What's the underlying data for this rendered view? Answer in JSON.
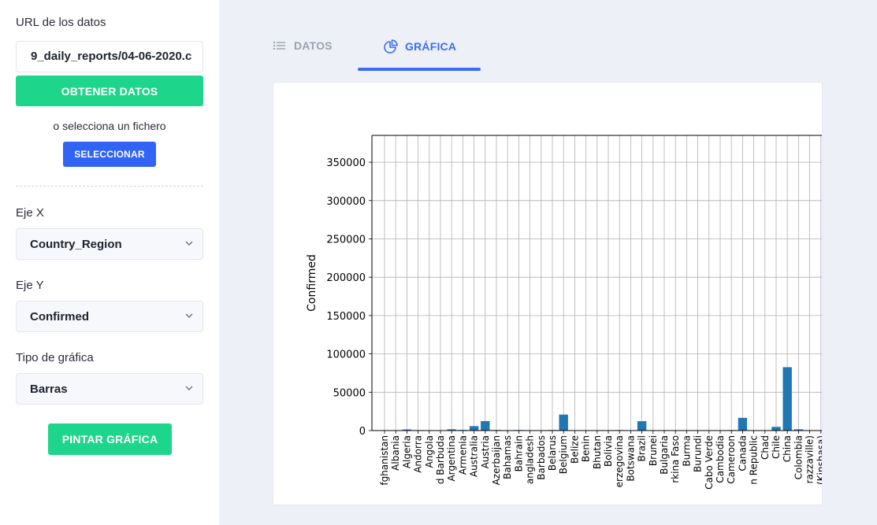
{
  "sidebar": {
    "url_label": "URL de los datos",
    "url_value": "9_daily_reports/04-06-2020.c",
    "fetch_button": "OBTENER DATOS",
    "or_select_text": "o selecciona un fichero",
    "select_button": "SELECCIONAR",
    "x_axis_label": "Eje X",
    "x_axis_value": "Country_Region",
    "y_axis_label": "Eje Y",
    "y_axis_value": "Confirmed",
    "chart_type_label": "Tipo de gráfica",
    "chart_type_value": "Barras",
    "paint_button": "PINTAR GRÁFICA"
  },
  "tabs": [
    {
      "label": "DATOS",
      "icon": "list-icon",
      "active": false
    },
    {
      "label": "GRÁFICA",
      "icon": "pie-chart-icon",
      "active": true
    }
  ],
  "colors": {
    "accent": "#3b6cf6",
    "green": "#1ed58c",
    "blue_button": "#3163f5",
    "bar": "#1f77b4"
  },
  "chart_data": {
    "type": "bar",
    "ylabel": "Confirmed",
    "ylim": [
      0,
      385000
    ],
    "yticks": [
      0,
      50000,
      100000,
      150000,
      200000,
      250000,
      300000,
      350000
    ],
    "ytick_labels": [
      "0",
      "50000",
      "100000",
      "150000",
      "200000",
      "250000",
      "300000",
      "350000"
    ],
    "grid": true,
    "categories": [
      "fghanistan",
      "Albania",
      "Algeria",
      "Andorra",
      "Angola",
      "d Barbuda",
      "Argentina",
      "Armenia",
      "Australia",
      "Austria",
      "Azerbaijan",
      "Bahamas",
      "Bahrain",
      "angladesh",
      "Barbados",
      "Belarus",
      "Belgium",
      "Belize",
      "Benin",
      "Bhutan",
      "Bolivia",
      "erzegovina",
      "Botswana",
      "Brazil",
      "Brunei",
      "Bulgaria",
      "rkina Faso",
      "Burma",
      "Burundi",
      "Cabo Verde",
      "Cambodia",
      "Cameroon",
      "Canada",
      "n Republic",
      "Chad",
      "Chile",
      "China",
      "Colombia",
      "razzaville)",
      "(Kinshasa)"
    ],
    "values": [
      367,
      377,
      1423,
      545,
      16,
      15,
      1628,
      833,
      5795,
      12297,
      717,
      36,
      700,
      123,
      63,
      700,
      20814,
      7,
      26,
      5,
      183,
      654,
      6,
      12161,
      135,
      531,
      364,
      21,
      0,
      7,
      114,
      650,
      16563,
      8,
      9,
      4815,
      82665,
      1579,
      45,
      180
    ]
  }
}
